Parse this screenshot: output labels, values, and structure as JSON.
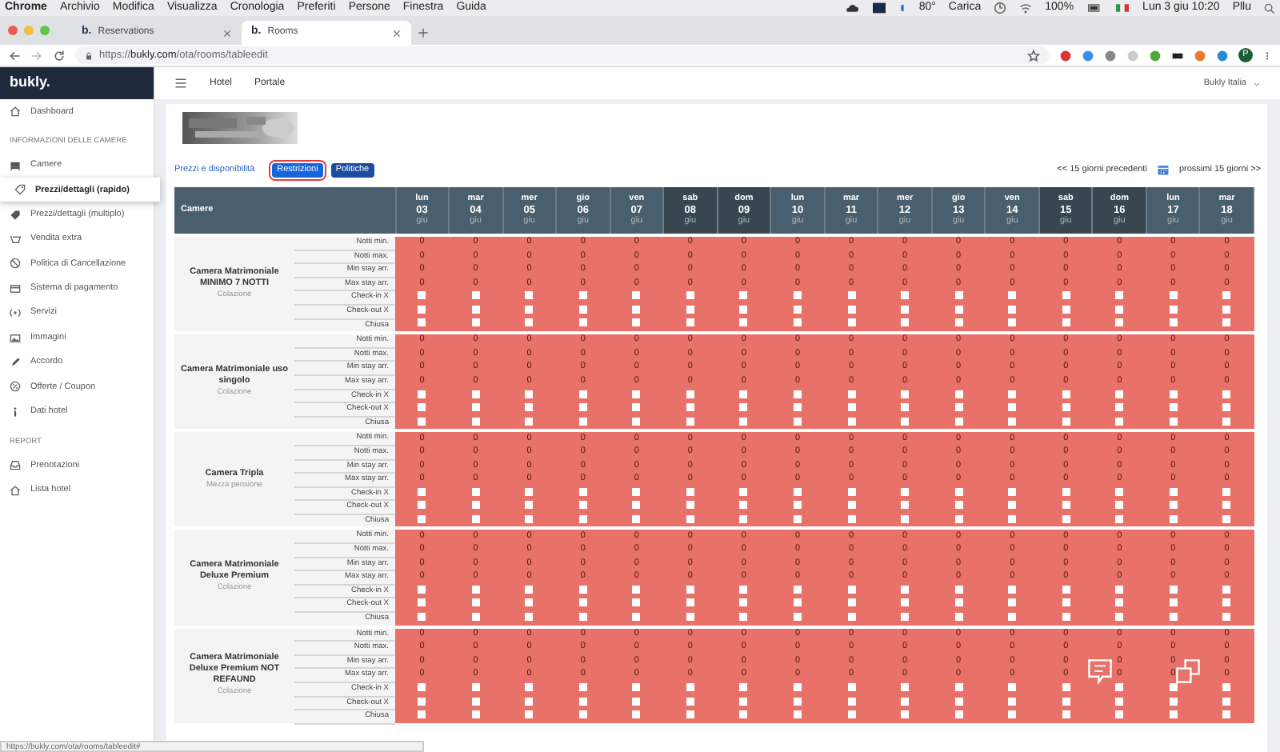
{
  "menubar": {
    "app": "Chrome",
    "menus": [
      "Archivio",
      "Modifica",
      "Visualizza",
      "Cronologia",
      "Preferiti",
      "Persone",
      "Finestra",
      "Guida"
    ],
    "status": [
      "80°",
      "Carica",
      "100%",
      "Lun 3 giu 10:20",
      "Pllu"
    ]
  },
  "tabs": [
    {
      "favicon_text": "b.",
      "title": "Reservations",
      "selected": false
    },
    {
      "favicon_text": "b.",
      "title": "Rooms",
      "selected": true
    }
  ],
  "address_bar": {
    "url": "https://**bukly.com**/ota/rooms/tableedit",
    "profile_initial": "P"
  },
  "app_header": {
    "logo": "bukly.",
    "nav": [
      "Hotel",
      "Portale"
    ],
    "account": "Bukly Italia"
  },
  "sidebar": [
    {
      "kind": "item",
      "label": "Dashboard",
      "selected": false
    },
    {
      "kind": "heading",
      "label": "INFORMAZIONI DELLE CAMERE"
    },
    {
      "kind": "item",
      "label": "Camere",
      "selected": false,
      "children": [
        {
          "label": "Prezzi/dettagli (rapido)",
          "selected": true
        }
      ]
    },
    {
      "kind": "item",
      "label": "Prezzi/dettagli (multiplo)",
      "selected": false
    },
    {
      "kind": "item",
      "label": "Vendita extra",
      "selected": false
    },
    {
      "kind": "item",
      "label": "Politica di Cancellazione",
      "selected": false
    },
    {
      "kind": "item",
      "label": "Sistema di pagamento",
      "selected": false
    },
    {
      "kind": "item",
      "label": "Servizi",
      "selected": false
    },
    {
      "kind": "item",
      "label": "Immagini",
      "selected": false
    },
    {
      "kind": "item",
      "label": "Accordo",
      "selected": false
    },
    {
      "kind": "item",
      "label": "Offerte / Coupon",
      "selected": false
    },
    {
      "kind": "item",
      "label": "Dati hotel",
      "selected": false
    },
    {
      "kind": "heading",
      "label": "REPORT"
    },
    {
      "kind": "item",
      "label": "Prenotazioni",
      "selected": false
    },
    {
      "kind": "item",
      "label": "Lista hotel",
      "selected": false
    }
  ],
  "view_tabs": [
    {
      "kind": "link",
      "label": "Prezzi e disponibilità",
      "selected": false
    },
    {
      "kind": "button",
      "label": "Restrizioni",
      "selected": true
    },
    {
      "kind": "button",
      "label": "Politiche",
      "selected": false
    }
  ],
  "pager": {
    "previous": "<< 15 giorni precedenti",
    "next": "prossimi 15 giorni >>"
  },
  "table": {
    "first_column": "Camere",
    "days": [
      {
        "weekday": "lun",
        "day": "03",
        "month": "giu",
        "weekend": false
      },
      {
        "weekday": "mar",
        "day": "04",
        "month": "giu",
        "weekend": false
      },
      {
        "weekday": "mer",
        "day": "05",
        "month": "giu",
        "weekend": false
      },
      {
        "weekday": "gio",
        "day": "06",
        "month": "giu",
        "weekend": false
      },
      {
        "weekday": "ven",
        "day": "07",
        "month": "giu",
        "weekend": false
      },
      {
        "weekday": "sab",
        "day": "08",
        "month": "giu",
        "weekend": true
      },
      {
        "weekday": "dom",
        "day": "09",
        "month": "giu",
        "weekend": true
      },
      {
        "weekday": "lun",
        "day": "10",
        "month": "giu",
        "weekend": false
      },
      {
        "weekday": "mar",
        "day": "11",
        "month": "giu",
        "weekend": false
      },
      {
        "weekday": "mer",
        "day": "12",
        "month": "giu",
        "weekend": false
      },
      {
        "weekday": "gio",
        "day": "13",
        "month": "giu",
        "weekend": false
      },
      {
        "weekday": "ven",
        "day": "14",
        "month": "giu",
        "weekend": false
      },
      {
        "weekday": "sab",
        "day": "15",
        "month": "giu",
        "weekend": true
      },
      {
        "weekday": "dom",
        "day": "16",
        "month": "giu",
        "weekend": true
      },
      {
        "weekday": "lun",
        "day": "17",
        "month": "giu",
        "weekend": false
      },
      {
        "weekday": "mar",
        "day": "18",
        "month": "giu",
        "weekend": false
      }
    ],
    "rooms": [
      {
        "name": "Camera Matrimoniale MINIMO 7 NOTTI",
        "subtitle": "Colazione",
        "rows": [
          {
            "label": "Notti min.",
            "kind": "number",
            "cells": [
              "0",
              "0",
              "0",
              "0",
              "0",
              "0",
              "0",
              "0",
              "0",
              "0",
              "0",
              "0",
              "0",
              "0",
              "0",
              "0"
            ]
          },
          {
            "label": "Notti max.",
            "kind": "number",
            "cells": [
              "0",
              "0",
              "0",
              "0",
              "0",
              "0",
              "0",
              "0",
              "0",
              "0",
              "0",
              "0",
              "0",
              "0",
              "0",
              "0"
            ]
          },
          {
            "label": "Min stay arr.",
            "kind": "number",
            "cells": [
              "0",
              "0",
              "0",
              "0",
              "0",
              "0",
              "0",
              "0",
              "0",
              "0",
              "0",
              "0",
              "0",
              "0",
              "0",
              "0"
            ]
          },
          {
            "label": "Max stay arr.",
            "kind": "number",
            "cells": [
              "0",
              "0",
              "0",
              "0",
              "0",
              "0",
              "0",
              "0",
              "0",
              "0",
              "0",
              "0",
              "0",
              "0",
              "0",
              "0"
            ]
          },
          {
            "label": "Check-in X",
            "kind": "checkbox",
            "checked": [
              false,
              false,
              false,
              false,
              false,
              false,
              false,
              false,
              false,
              false,
              false,
              false,
              false,
              false,
              false,
              false
            ]
          },
          {
            "label": "Check-out X",
            "kind": "checkbox",
            "checked": [
              false,
              false,
              false,
              false,
              false,
              false,
              false,
              false,
              false,
              false,
              false,
              false,
              false,
              false,
              false,
              false
            ]
          },
          {
            "label": "Chiusa",
            "kind": "checkbox",
            "checked": [
              false,
              false,
              false,
              false,
              false,
              false,
              false,
              false,
              false,
              false,
              false,
              false,
              false,
              false,
              false,
              false
            ]
          }
        ]
      },
      {
        "name": "Camera Matrimoniale uso singolo",
        "subtitle": "Colazione",
        "rows": [
          {
            "label": "Notti min.",
            "kind": "number",
            "cells": [
              "0",
              "0",
              "0",
              "0",
              "0",
              "0",
              "0",
              "0",
              "0",
              "0",
              "0",
              "0",
              "0",
              "0",
              "0",
              "0"
            ]
          },
          {
            "label": "Notti max.",
            "kind": "number",
            "cells": [
              "0",
              "0",
              "0",
              "0",
              "0",
              "0",
              "0",
              "0",
              "0",
              "0",
              "0",
              "0",
              "0",
              "0",
              "0",
              "0"
            ]
          },
          {
            "label": "Min stay arr.",
            "kind": "number",
            "cells": [
              "0",
              "0",
              "0",
              "0",
              "0",
              "0",
              "0",
              "0",
              "0",
              "0",
              "0",
              "0",
              "0",
              "0",
              "0",
              "0"
            ]
          },
          {
            "label": "Max stay arr.",
            "kind": "number",
            "cells": [
              "0",
              "0",
              "0",
              "0",
              "0",
              "0",
              "0",
              "0",
              "0",
              "0",
              "0",
              "0",
              "0",
              "0",
              "0",
              "0"
            ]
          },
          {
            "label": "Check-in X",
            "kind": "checkbox",
            "checked": [
              false,
              false,
              false,
              false,
              false,
              false,
              false,
              false,
              false,
              false,
              false,
              false,
              false,
              false,
              false,
              false
            ]
          },
          {
            "label": "Check-out X",
            "kind": "checkbox",
            "checked": [
              false,
              false,
              false,
              false,
              false,
              false,
              false,
              false,
              false,
              false,
              false,
              false,
              false,
              false,
              false,
              false
            ]
          },
          {
            "label": "Chiusa",
            "kind": "checkbox",
            "checked": [
              false,
              false,
              false,
              false,
              false,
              false,
              false,
              false,
              false,
              false,
              false,
              false,
              false,
              false,
              false,
              false
            ]
          }
        ]
      },
      {
        "name": "Camera Tripla",
        "subtitle": "Mezza pensione",
        "rows": [
          {
            "label": "Notti min.",
            "kind": "number",
            "cells": [
              "0",
              "0",
              "0",
              "0",
              "0",
              "0",
              "0",
              "0",
              "0",
              "0",
              "0",
              "0",
              "0",
              "0",
              "0",
              "0"
            ]
          },
          {
            "label": "Notti max.",
            "kind": "number",
            "cells": [
              "0",
              "0",
              "0",
              "0",
              "0",
              "0",
              "0",
              "0",
              "0",
              "0",
              "0",
              "0",
              "0",
              "0",
              "0",
              "0"
            ]
          },
          {
            "label": "Min stay arr.",
            "kind": "number",
            "cells": [
              "0",
              "0",
              "0",
              "0",
              "0",
              "0",
              "0",
              "0",
              "0",
              "0",
              "0",
              "0",
              "0",
              "0",
              "0",
              "0"
            ]
          },
          {
            "label": "Max stay arr.",
            "kind": "number",
            "cells": [
              "0",
              "0",
              "0",
              "0",
              "0",
              "0",
              "0",
              "0",
              "0",
              "0",
              "0",
              "0",
              "0",
              "0",
              "0",
              "0"
            ]
          },
          {
            "label": "Check-in X",
            "kind": "checkbox",
            "checked": [
              false,
              false,
              false,
              false,
              false,
              false,
              false,
              false,
              false,
              false,
              false,
              false,
              false,
              false,
              false,
              false
            ]
          },
          {
            "label": "Check-out X",
            "kind": "checkbox",
            "checked": [
              false,
              false,
              false,
              false,
              false,
              false,
              false,
              false,
              false,
              false,
              false,
              false,
              false,
              false,
              false,
              false
            ]
          },
          {
            "label": "Chiusa",
            "kind": "checkbox",
            "checked": [
              false,
              false,
              false,
              false,
              false,
              false,
              false,
              false,
              false,
              false,
              false,
              false,
              false,
              false,
              false,
              false
            ]
          }
        ]
      },
      {
        "name": "Camera Matrimoniale Deluxe Premium",
        "subtitle": "Colazione",
        "rows": [
          {
            "label": "Notti min.",
            "kind": "number",
            "cells": [
              "0",
              "0",
              "0",
              "0",
              "0",
              "0",
              "0",
              "0",
              "0",
              "0",
              "0",
              "0",
              "0",
              "0",
              "0",
              "0"
            ]
          },
          {
            "label": "Notti max.",
            "kind": "number",
            "cells": [
              "0",
              "0",
              "0",
              "0",
              "0",
              "0",
              "0",
              "0",
              "0",
              "0",
              "0",
              "0",
              "0",
              "0",
              "0",
              "0"
            ]
          },
          {
            "label": "Min stay arr.",
            "kind": "number",
            "cells": [
              "0",
              "0",
              "0",
              "0",
              "0",
              "0",
              "0",
              "0",
              "0",
              "0",
              "0",
              "0",
              "0",
              "0",
              "0",
              "0"
            ]
          },
          {
            "label": "Max stay arr.",
            "kind": "number",
            "cells": [
              "0",
              "0",
              "0",
              "0",
              "0",
              "0",
              "0",
              "0",
              "0",
              "0",
              "0",
              "0",
              "0",
              "0",
              "0",
              "0"
            ]
          },
          {
            "label": "Check-in X",
            "kind": "checkbox",
            "checked": [
              false,
              false,
              false,
              false,
              false,
              false,
              false,
              false,
              false,
              false,
              false,
              false,
              false,
              false,
              false,
              false
            ]
          },
          {
            "label": "Check-out X",
            "kind": "checkbox",
            "checked": [
              false,
              false,
              false,
              false,
              false,
              false,
              false,
              false,
              false,
              false,
              false,
              false,
              false,
              false,
              false,
              false
            ]
          },
          {
            "label": "Chiusa",
            "kind": "checkbox",
            "checked": [
              false,
              false,
              false,
              false,
              false,
              false,
              false,
              false,
              false,
              false,
              false,
              false,
              false,
              false,
              false,
              false
            ]
          }
        ]
      },
      {
        "name": "Camera Matrimoniale Deluxe Premium NOT REFAUND",
        "subtitle": "Colazione",
        "rows": [
          {
            "label": "Notti min.",
            "kind": "number",
            "cells": [
              "0",
              "0",
              "0",
              "0",
              "0",
              "0",
              "0",
              "0",
              "0",
              "0",
              "0",
              "0",
              "0",
              "0",
              "0",
              "0"
            ]
          },
          {
            "label": "Notti max.",
            "kind": "number",
            "cells": [
              "0",
              "0",
              "0",
              "0",
              "0",
              "0",
              "0",
              "0",
              "0",
              "0",
              "0",
              "0",
              "0",
              "0",
              "0",
              "0"
            ]
          },
          {
            "label": "Min stay arr.",
            "kind": "number",
            "cells": [
              "0",
              "0",
              "0",
              "0",
              "0",
              "0",
              "0",
              "0",
              "0",
              "0",
              "0",
              "0",
              "0",
              "0",
              "0",
              "0"
            ]
          },
          {
            "label": "Max stay arr.",
            "kind": "number",
            "cells": [
              "0",
              "0",
              "0",
              "0",
              "0",
              "0",
              "0",
              "0",
              "0",
              "0",
              "0",
              "0",
              "0",
              "0",
              "0",
              "0"
            ]
          },
          {
            "label": "Check-in X",
            "kind": "checkbox",
            "checked": [
              false,
              false,
              false,
              false,
              false,
              false,
              false,
              false,
              false,
              false,
              false,
              false,
              false,
              false,
              false,
              false
            ]
          },
          {
            "label": "Check-out X",
            "kind": "checkbox",
            "checked": [
              false,
              false,
              false,
              false,
              false,
              false,
              false,
              false,
              false,
              false,
              false,
              false,
              false,
              false,
              false,
              false
            ]
          },
          {
            "label": "Chiusa",
            "kind": "checkbox",
            "checked": [
              false,
              false,
              false,
              false,
              false,
              false,
              false,
              false,
              false,
              false,
              false,
              false,
              false,
              false,
              false,
              false
            ]
          }
        ]
      }
    ]
  },
  "status_url": "https://bukly.com/ota/rooms/tableedit#"
}
